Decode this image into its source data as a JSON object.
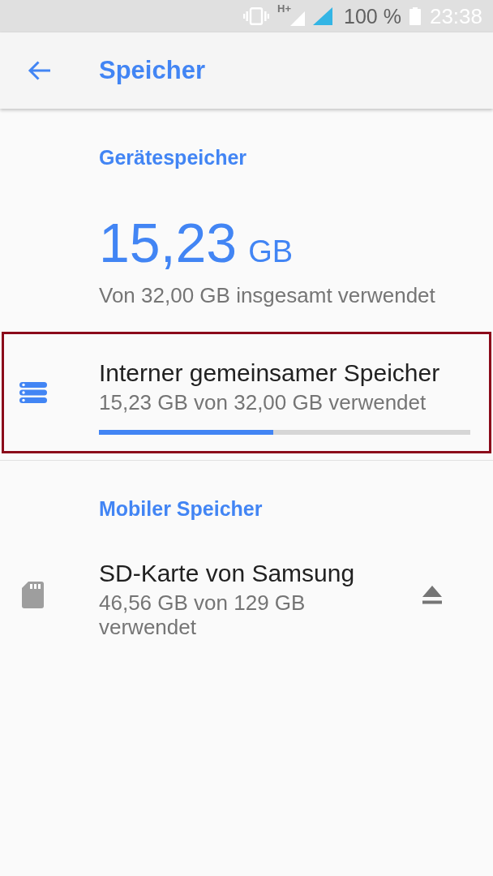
{
  "status_bar": {
    "network_type": "H+",
    "battery": "100 %",
    "time": "23:38"
  },
  "toolbar": {
    "title": "Speicher"
  },
  "sections": [
    {
      "header": "Gerätespeicher",
      "total": {
        "value": "15,23",
        "unit": "GB",
        "caption": "Von 32,00 GB insgesamt verwendet"
      },
      "volumes": [
        {
          "kind": "internal",
          "title": "Interner gemeinsamer Speicher",
          "subtitle": "15,23 GB von 32,00 GB verwendet",
          "level": 0.47,
          "highlighted": true
        }
      ]
    },
    {
      "header": "Mobiler Speicher",
      "volumes": [
        {
          "kind": "sd_card",
          "title": "SD-Karte von Samsung",
          "subtitle": "46,56 GB von 129 GB verwendet",
          "highlighted": false
        }
      ]
    }
  ]
}
